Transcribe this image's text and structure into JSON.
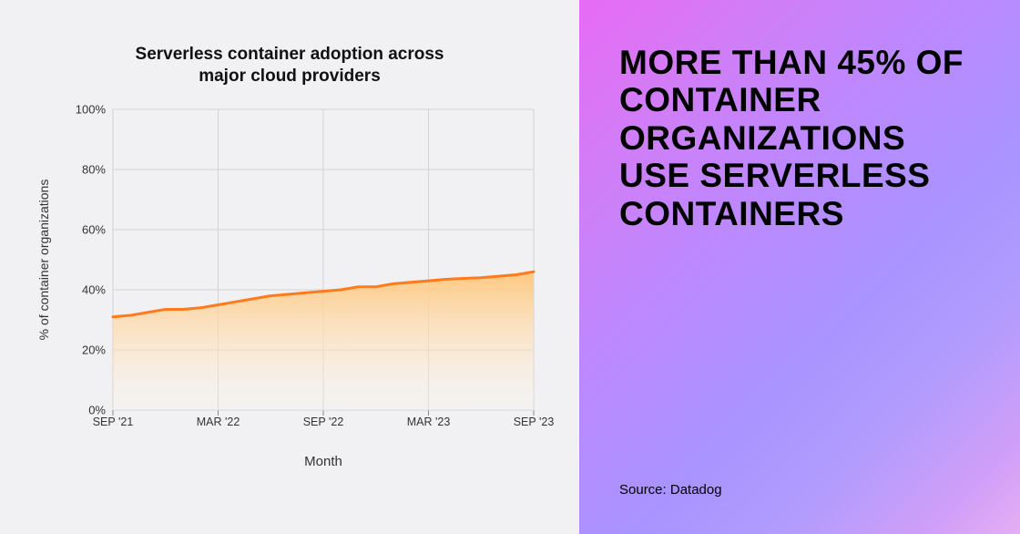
{
  "right_panel": {
    "headline": "MORE THAN 45% OF CONTAINER ORGANIZATIONS USE SERVERLESS CONTAINERS",
    "source": "Source: Datadog"
  },
  "chart_data": {
    "type": "area",
    "title": "Serverless container adoption across major cloud providers",
    "xlabel": "Month",
    "ylabel": "% of container organizations",
    "ylim": [
      0,
      100
    ],
    "yticks": [
      0,
      20,
      40,
      60,
      80,
      100
    ],
    "ytick_labels": [
      "0%",
      "20%",
      "40%",
      "60%",
      "80%",
      "100%"
    ],
    "categories": [
      "SEP '21",
      "MAR '22",
      "SEP '22",
      "MAR '23",
      "SEP '23"
    ],
    "x_index": [
      0,
      1,
      2,
      3,
      4,
      5,
      6,
      7,
      8,
      9,
      10,
      11,
      12,
      13,
      14,
      15,
      16,
      17,
      18,
      19,
      20,
      21,
      22,
      23,
      24
    ],
    "x_tick_index": [
      0,
      6,
      12,
      18,
      24
    ],
    "values": [
      31,
      31.5,
      32.5,
      33.5,
      33.5,
      34,
      35,
      36,
      37,
      38,
      38.5,
      39,
      39.5,
      40,
      41,
      41,
      42,
      42.5,
      43,
      43.5,
      43.8,
      44,
      44.5,
      45,
      46
    ],
    "line_color": "#ff7a1a",
    "fill_top": "#ffc67a",
    "fill_bottom": "#fff6ea"
  }
}
